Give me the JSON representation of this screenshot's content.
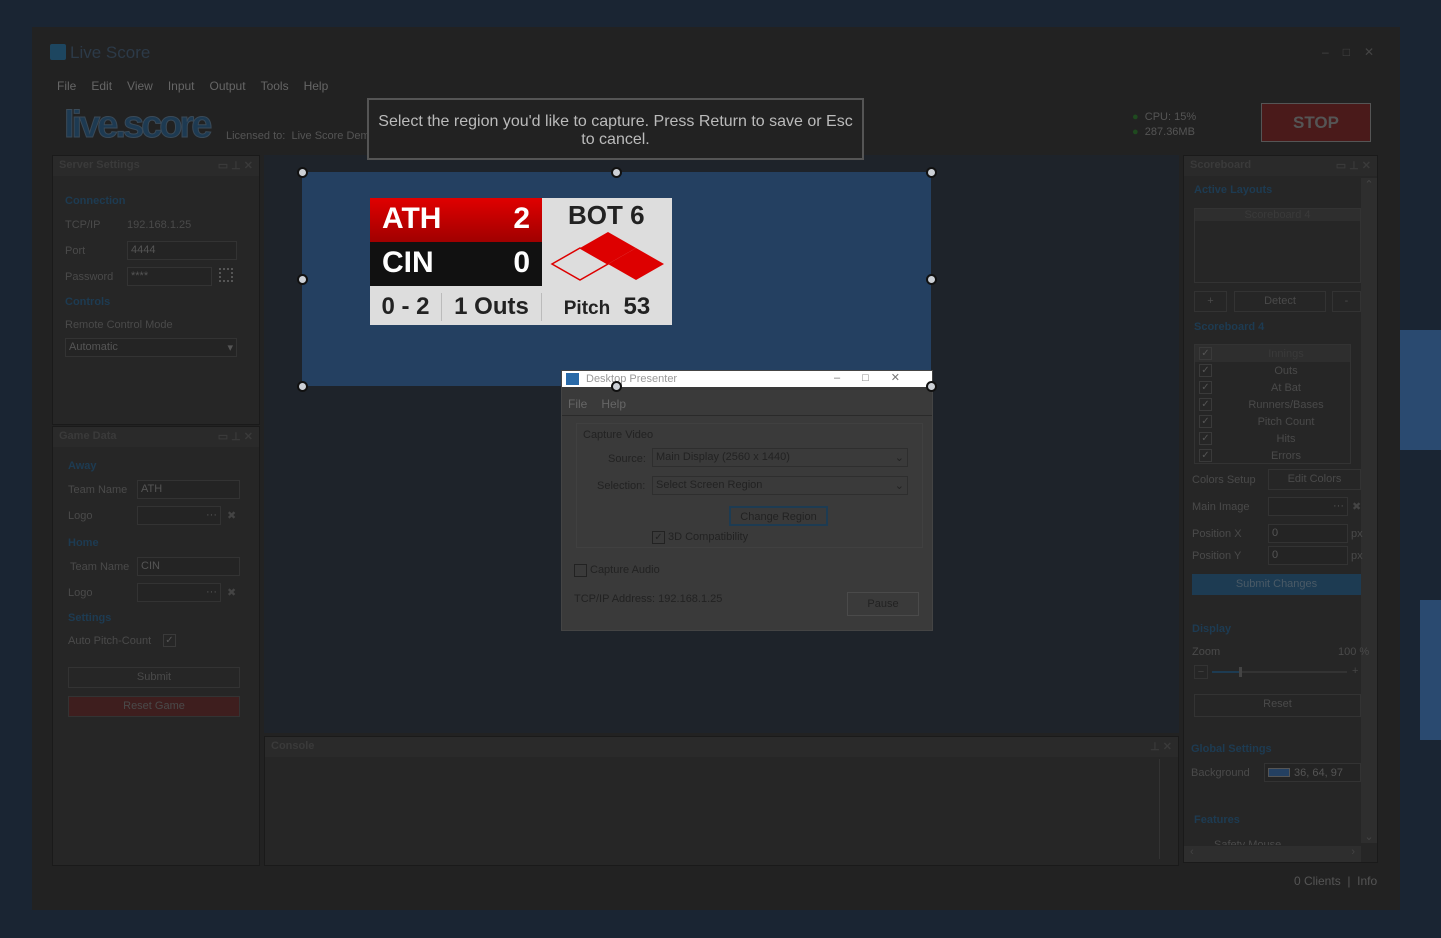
{
  "app": {
    "title": "Live Score",
    "logo": "live.score",
    "licensed_label": "Licensed to:",
    "licensed_to": "Live Score Dem",
    "menu": [
      "File",
      "Edit",
      "View",
      "Input",
      "Output",
      "Tools",
      "Help"
    ],
    "cpu": "CPU: 15%",
    "memory": "287.36MB",
    "stop": "STOP"
  },
  "capture_prompt": "Select the region you'd like to capture.  Press Return to save or Esc to cancel.",
  "server": {
    "title": "Server Settings",
    "connection": "Connection",
    "tcp_label": "TCP/IP",
    "tcp_value": "192.168.1.25",
    "port_label": "Port",
    "port_value": "4444",
    "password_label": "Password",
    "password_value": "****",
    "controls": "Controls",
    "remote_label": "Remote Control Mode",
    "remote_value": "Automatic"
  },
  "game": {
    "title": "Game Data",
    "away": "Away",
    "home": "Home",
    "team_label": "Team Name",
    "logo_label": "Logo",
    "away_team": "ATH",
    "home_team": "CIN",
    "settings": "Settings",
    "auto_pitch": "Auto Pitch-Count",
    "submit": "Submit",
    "reset": "Reset Game"
  },
  "scoreboard_preview": {
    "away": "ATH",
    "away_score": "2",
    "home": "CIN",
    "home_score": "0",
    "inning": "BOT 6",
    "count": "0 - 2",
    "outs": "1 Outs",
    "pitch_label": "Pitch",
    "pitch": "53"
  },
  "console": {
    "title": "Console"
  },
  "presenter": {
    "title": "Desktop Presenter",
    "menu": [
      "File",
      "Help"
    ],
    "group": "Capture Video",
    "source_label": "Source:",
    "source_value": "Main Display (2560 x 1440)",
    "selection_label": "Selection:",
    "selection_value": "Select Screen Region",
    "change_region": "Change Region",
    "compat": "3D Compatibility",
    "audio": "Capture Audio",
    "tcp": "TCP/IP Address:  192.168.1.25",
    "pause": "Pause"
  },
  "right": {
    "title": "Scoreboard",
    "active_layouts": "Active Layouts",
    "layouts": [
      "Scoreboard 4"
    ],
    "add": "+",
    "detect": "Detect",
    "remove": "-",
    "section": "Scoreboard 4",
    "elements": [
      "Innings",
      "Outs",
      "At Bat",
      "Runners/Bases",
      "Pitch Count",
      "Hits",
      "Errors"
    ],
    "colors_label": "Colors Setup",
    "edit_colors": "Edit Colors",
    "main_image": "Main Image",
    "posx_label": "Position X",
    "posx": "0",
    "posy_label": "Position Y",
    "posy": "0",
    "px": "px",
    "submit": "Submit Changes",
    "display": "Display",
    "zoom_label": "Zoom",
    "zoom_value": "100 %",
    "zoom_level": 0.2,
    "reset": "Reset",
    "global": "Global Settings",
    "background_label": "Background",
    "background_value": "36, 64, 97",
    "background_color": "#244061",
    "features": "Features",
    "safety": "Safety Mouse"
  },
  "status": {
    "clients": "0 Clients",
    "info": "Info"
  },
  "colors": {
    "away": "#c00000",
    "home": "#111111",
    "selection": "#244061",
    "accent": "#1d4660",
    "stop": "#4a1a1a"
  }
}
